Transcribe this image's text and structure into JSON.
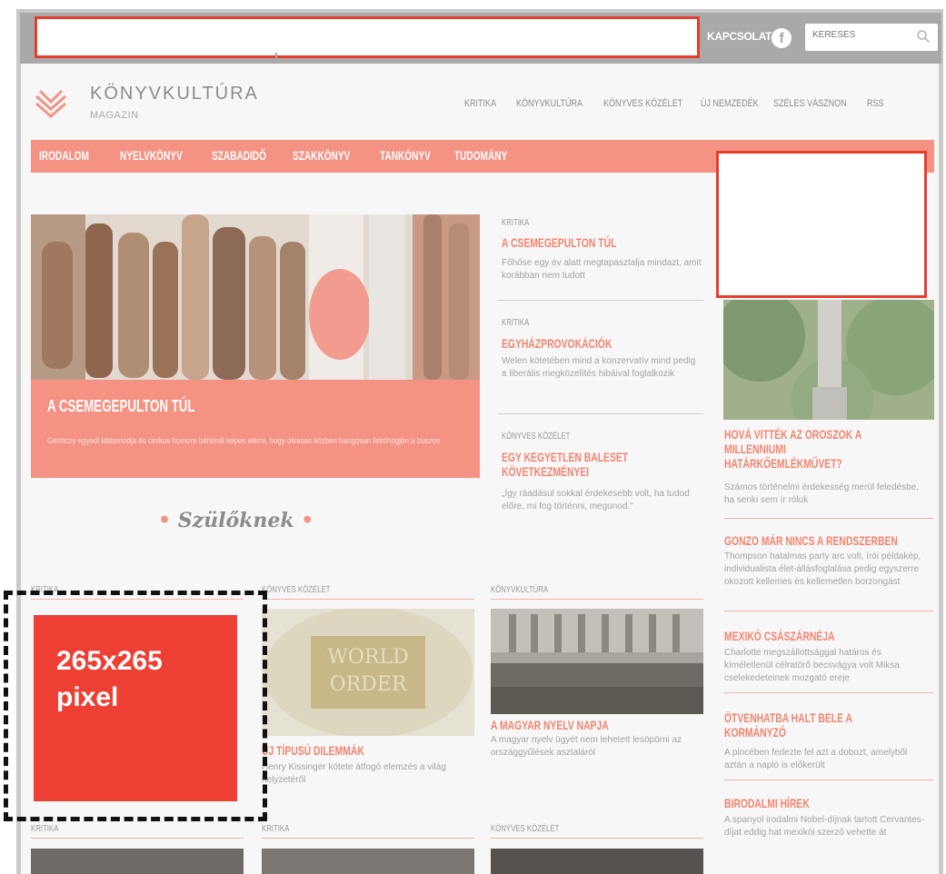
{
  "topbar": {
    "contact_label": "KAPCSOLAT",
    "facebook_icon": "facebook-icon",
    "search_placeholder": "KERESÉS"
  },
  "brand": {
    "title": "KÖNYVKULTÚRA",
    "subtitle": "MAGAZIN"
  },
  "topnav": [
    "KRITIKA",
    "KÖNYVKULTÚRA",
    "KÖNYVES KÖZÉLET",
    "ÚJ NEMZEDÉK",
    "SZÉLES VÁSZNON",
    "RSS"
  ],
  "categories": [
    "IRODALOM",
    "NYELVKÖNYV",
    "SZABADIDŐ",
    "SZAKKÖNYV",
    "TANKÖNYV",
    "TUDOMÁNY"
  ],
  "hero": {
    "title": "A CSEMEGEPULTON TÚL",
    "desc": "Gerlóczy egyedi látásmódja és cinikus humora bárkinél képes elérni, hogy olvasás közben hangosan felröhögjön a buszon"
  },
  "middle_articles": [
    {
      "kicker": "KRITIKA",
      "title": "A CSEMEGEPULTON TÚL",
      "desc": "Főhőse egy év alatt megtapasztalja mindazt, amit korábban nem tudott"
    },
    {
      "kicker": "KRITIKA",
      "title": "EGYHÁZPROVOKÁCIÓK",
      "desc": "Welen kötetében mind a konzervatív mind pedig a liberális megközelítés hibáival foglalkozik"
    },
    {
      "kicker": "KÖNYVES KÖZÉLET",
      "title": "EGY KEGYETLEN BALESET KÖVETKEZMÉNYEI",
      "desc": "„Így ráadásul sokkal érdekesebb volt, ha tudod előre, mi fog történni, megunod.\""
    }
  ],
  "szuloknek": "Szülőknek",
  "side_articles": [
    {
      "title": "HOVÁ VITTÉK AZ OROSZOK A MILLENNIUMI HATÁRKŐEMLÉKMŰVET?",
      "desc": "Számos történelmi érdekesség merül feledésbe, ha senki sem ír róluk"
    },
    {
      "title": "GONZO MÁR NINCS A RENDSZERBEN",
      "desc": "Thompson hatalmas party arc volt, írói példakép, individualista élet-állásfoglalása pedig egyszerre okozott kellemes és kellemetlen borzongást"
    },
    {
      "title": "MEXIKÓ CSÁSZÁRNÉJA",
      "desc": "Charlotte megszállottsággal határos és kíméletlenül célratörő becsvágya volt Miksa cselekedeteinek mozgató ereje"
    },
    {
      "title": "ÖTVENHATBA HALT BELE A KORMÁNYZÓ",
      "desc": "A pincében fedezte fel azt a dobozt, amelyből aztán a napló is előkerült"
    },
    {
      "title": "BIRODALMI HÍREK",
      "desc": "A spanyol irodalmi Nobel-díjnak tartott Cervantes-díjat eddig hat mexikói szerző vehette át"
    }
  ],
  "grid_row1": [
    {
      "kicker": "KRITIKA"
    },
    {
      "kicker": "KÖNYVES KÖZÉLET",
      "title": "ÚJ TÍPUSÚ DILEMMÁK",
      "desc": "Henry Kissinger kötete átfogó elemzés a világ helyzetéről",
      "image_text_1": "WORLD",
      "image_text_2": "ORDER"
    },
    {
      "kicker": "KÖNYVKULTÚRA",
      "title": "A MAGYAR NYELV NAPJA",
      "desc": "A magyar nyelv ügyét nem lehetett lesöpörni az országgyűlések asztaláról"
    }
  ],
  "ad_square": {
    "line1": "265x265",
    "line2": "pixel"
  },
  "grid_row2": [
    "KRITIKA",
    "KRITIKA",
    "KÖNYVES KÖZÉLET"
  ],
  "colors": {
    "accent": "#f49283",
    "ad_red": "#ee3f34",
    "title_orange": "#f2846f"
  }
}
